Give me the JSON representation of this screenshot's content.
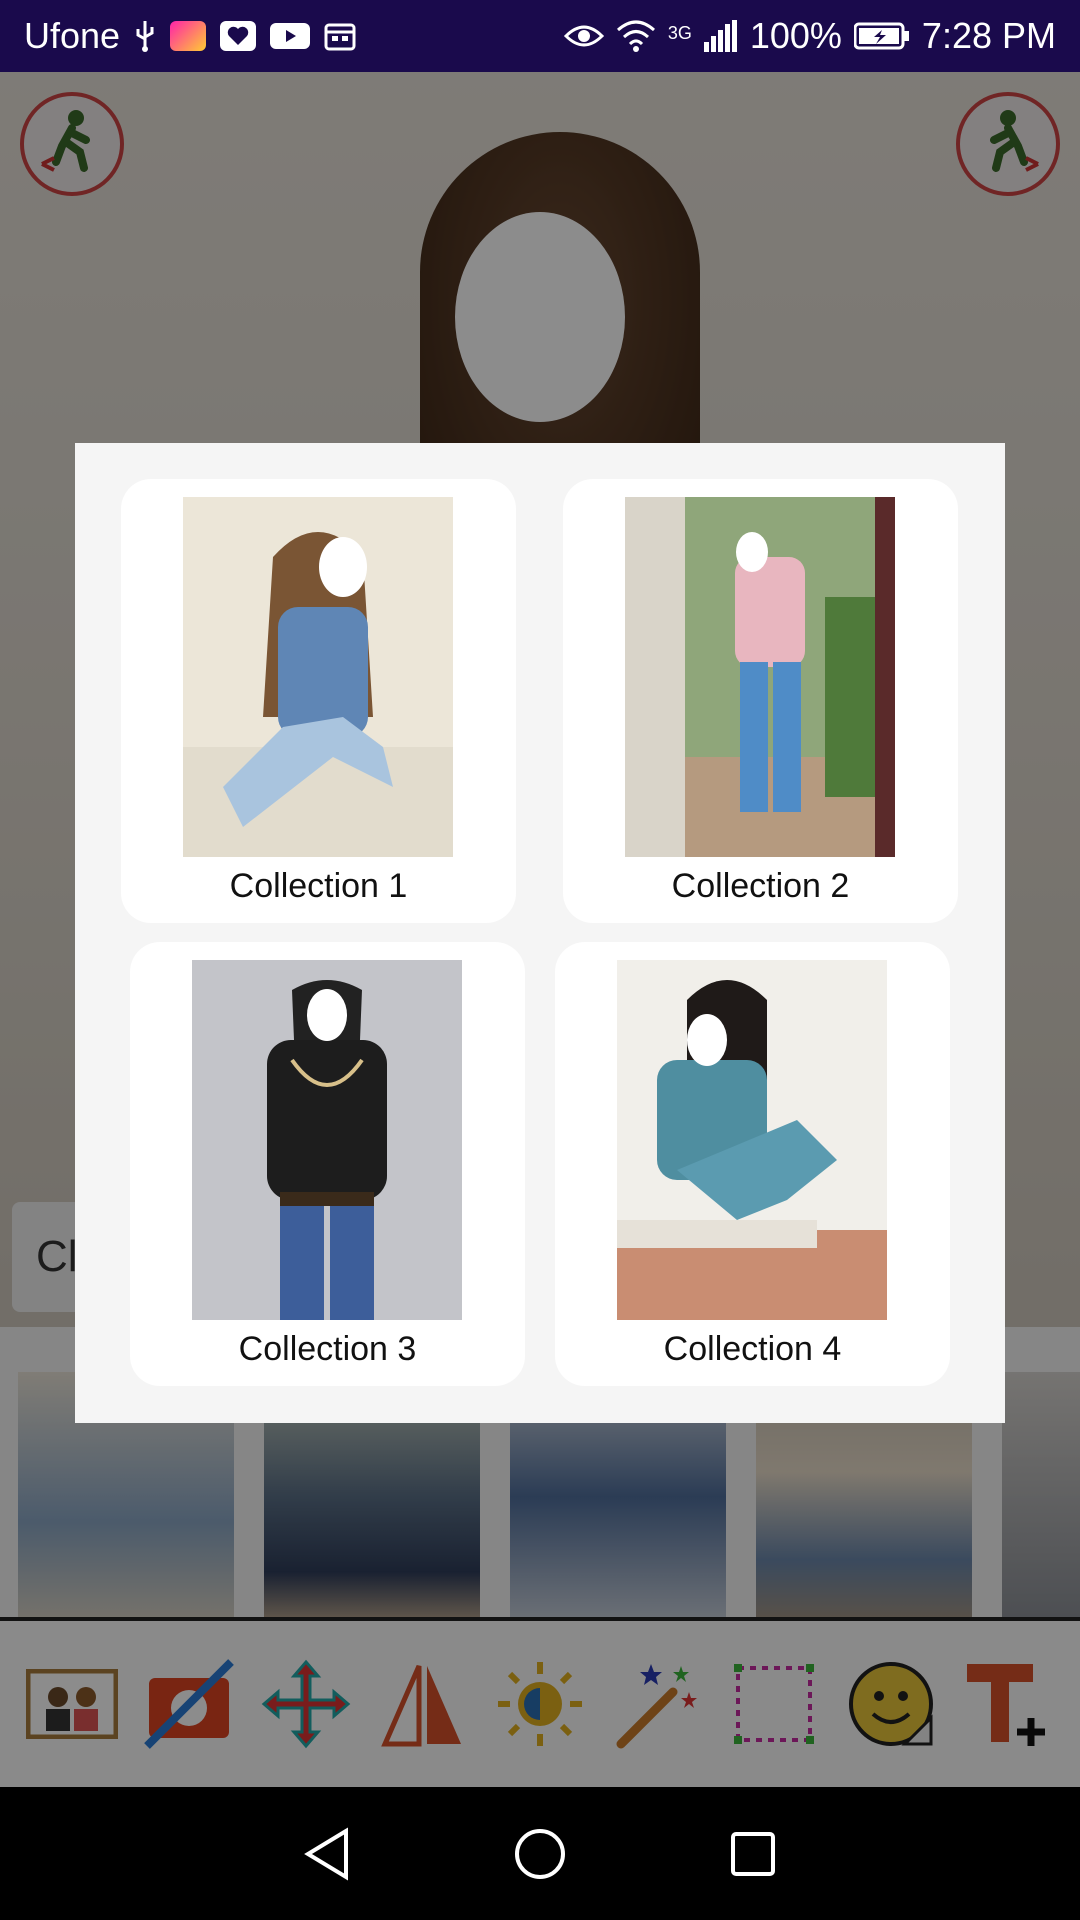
{
  "status_bar": {
    "carrier": "Ufone",
    "network": "3G",
    "battery": "100%",
    "time": "7:28 PM"
  },
  "app": {
    "caption_stub": "Cl"
  },
  "dialog": {
    "collections": [
      {
        "label": "Collection 1"
      },
      {
        "label": "Collection 2"
      },
      {
        "label": "Collection 3"
      },
      {
        "label": "Collection 4"
      }
    ]
  },
  "toolbar": {
    "tools": [
      "couple-frame-icon",
      "hide-camera-icon",
      "move-icon",
      "flip-icon",
      "brightness-icon",
      "magic-wand-icon",
      "crop-frame-icon",
      "sticker-icon",
      "add-text-icon"
    ]
  },
  "navbar": {
    "keys": [
      "back-icon",
      "home-icon",
      "recents-icon"
    ]
  }
}
